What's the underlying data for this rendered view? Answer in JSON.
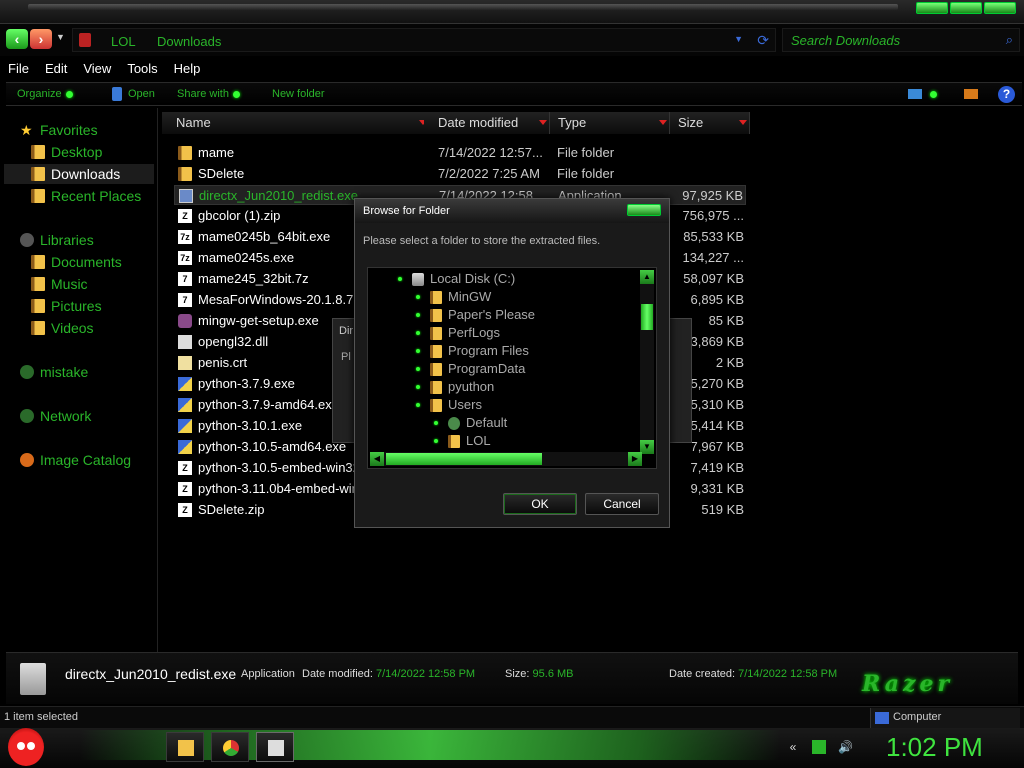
{
  "address": {
    "crumbs": [
      "LOL",
      "Downloads"
    ],
    "search_placeholder": "Search Downloads"
  },
  "menu": [
    "File",
    "Edit",
    "View",
    "Tools",
    "Help"
  ],
  "commands": {
    "organize": "Organize",
    "open": "Open",
    "share_with": "Share with",
    "new_folder": "New folder",
    "help": "?"
  },
  "nav": {
    "favorites": "Favorites",
    "desktop": "Desktop",
    "downloads": "Downloads",
    "recent_places": "Recent Places",
    "libraries": "Libraries",
    "documents": "Documents",
    "music": "Music",
    "pictures": "Pictures",
    "videos": "Videos",
    "mistake": "mistake",
    "network": "Network",
    "image_catalog": "Image Catalog"
  },
  "columns": {
    "name": "Name",
    "date": "Date modified",
    "type": "Type",
    "size": "Size"
  },
  "files": [
    {
      "name": "mame",
      "date": "7/14/2022 12:57...",
      "type": "File folder",
      "size": ""
    },
    {
      "name": "SDelete",
      "date": "7/2/2022 7:25 AM",
      "type": "File folder",
      "size": ""
    },
    {
      "name": "directx_Jun2010_redist.exe",
      "date": "7/14/2022 12:58 ...",
      "type": "Application",
      "size": "97,925 KB"
    },
    {
      "name": "gbcolor (1).zip",
      "date": "",
      "type": "",
      "size": "756,975 ..."
    },
    {
      "name": "mame0245b_64bit.exe",
      "date": "",
      "type": "",
      "size": "85,533 KB"
    },
    {
      "name": "mame0245s.exe",
      "date": "",
      "type": "",
      "size": "134,227 ..."
    },
    {
      "name": "mame245_32bit.7z",
      "date": "",
      "type": "",
      "size": "58,097 KB"
    },
    {
      "name": "MesaForWindows-20.1.8.7...",
      "date": "",
      "type": "",
      "size": "6,895 KB"
    },
    {
      "name": "mingw-get-setup.exe",
      "date": "",
      "type": "",
      "size": "85 KB"
    },
    {
      "name": "opengl32.dll",
      "date": "",
      "type": "",
      "size": "3,869 KB"
    },
    {
      "name": "penis.crt",
      "date": "",
      "type": "",
      "size": "2 KB"
    },
    {
      "name": "python-3.7.9.exe",
      "date": "",
      "type": "",
      "size": "5,270 KB"
    },
    {
      "name": "python-3.7.9-amd64.exe",
      "date": "",
      "type": "",
      "size": "5,310 KB"
    },
    {
      "name": "python-3.10.1.exe",
      "date": "",
      "type": "",
      "size": "5,414 KB"
    },
    {
      "name": "python-3.10.5-amd64.exe",
      "date": "",
      "type": "",
      "size": "7,967 KB"
    },
    {
      "name": "python-3.10.5-embed-win32...",
      "date": "",
      "type": "",
      "size": "7,419 KB"
    },
    {
      "name": "python-3.11.0b4-embed-win...",
      "date": "",
      "type": "",
      "size": "9,331 KB"
    },
    {
      "name": "SDelete.zip",
      "date": "",
      "type": "",
      "size": "519 KB"
    }
  ],
  "bg_dialog": {
    "title": "Dir",
    "text": "Pl"
  },
  "browse": {
    "title": "Browse for Folder",
    "message": "Please select a folder to store the extracted files.",
    "tree": [
      "Local Disk (C:)",
      "MinGW",
      "Paper's Please",
      "PerfLogs",
      "Program Files",
      "ProgramData",
      "pyuthon",
      "Users",
      "Default",
      "LOL"
    ],
    "ok": "OK",
    "cancel": "Cancel"
  },
  "details": {
    "name": "directx_Jun2010_redist.exe",
    "type": "Application",
    "date_modified_label": "Date modified:",
    "date_modified": "7/14/2022 12:58 PM",
    "size_label": "Size:",
    "size": "95.6 MB",
    "date_created_label": "Date created:",
    "date_created": "7/14/2022 12:58 PM",
    "brand": "Razer"
  },
  "status": {
    "count": "1 item selected",
    "location": "Computer"
  },
  "clock": "1:02 PM",
  "colors": {
    "accent_green": "#2ab52a",
    "background": "#000000",
    "clock_green": "#3fe33f"
  }
}
